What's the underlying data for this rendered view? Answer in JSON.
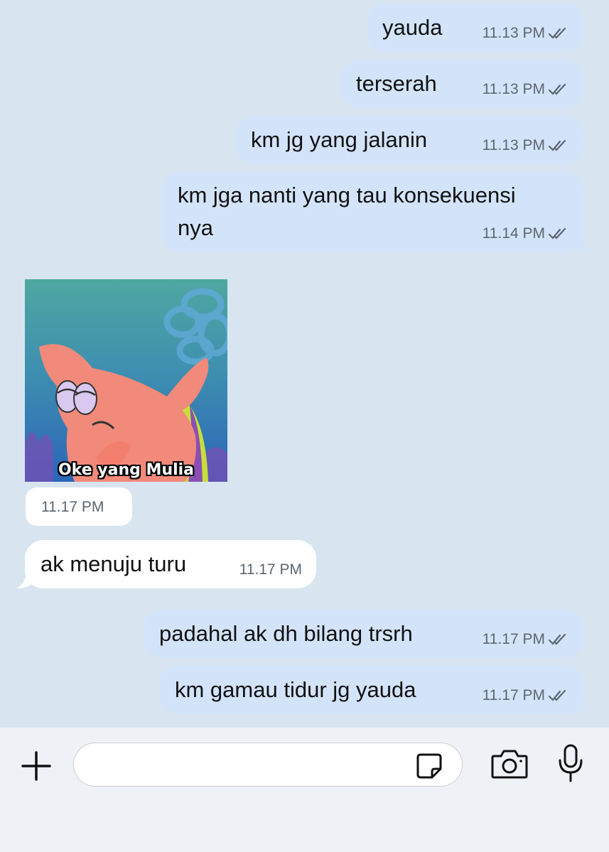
{
  "messages": [
    {
      "text": "yauda",
      "time": "11.13 PM"
    },
    {
      "text": "terserah",
      "time": "11.13 PM"
    },
    {
      "text": "km jg yang jalanin",
      "time": "11.13 PM"
    },
    {
      "text_line1": "km jga nanti yang tau konsekuensi",
      "text_line2": "nya",
      "time": "11.14 PM"
    },
    {
      "sticker_caption": "Oke yang Mulia",
      "time": "11.17 PM"
    },
    {
      "text": "ak menuju turu",
      "time": "11.17 PM"
    },
    {
      "text": "padahal ak dh bilang trsrh",
      "time": "11.17 PM"
    },
    {
      "text": "km gamau tidur jg yauda",
      "time": "11.17 PM"
    }
  ],
  "input": {
    "value": "",
    "placeholder": ""
  },
  "icons": {
    "plus": "plus-icon",
    "sticker": "sticker-icon",
    "camera": "camera-icon",
    "mic": "microphone-icon",
    "read": "double-check-icon"
  },
  "colors": {
    "background": "#d8e5f0",
    "outgoing_bubble": "#d3e4fa",
    "incoming_bubble": "#ffffff",
    "timestamp": "#5d6670"
  }
}
